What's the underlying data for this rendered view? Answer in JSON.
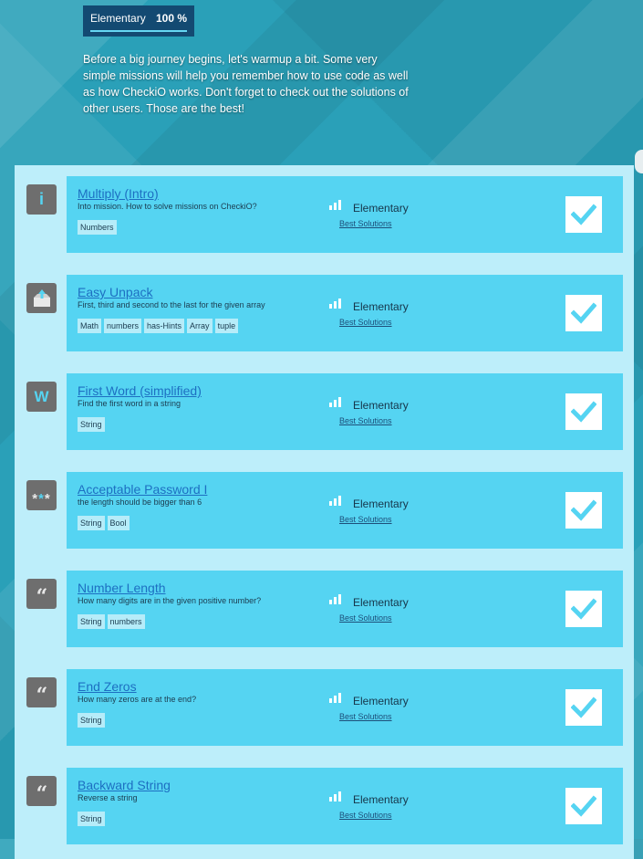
{
  "header": {
    "level_name": "Elementary",
    "progress_text": "100 %",
    "progress_fraction": 1.0,
    "intro_text": "Before a big journey begins, let's warmup a bit. Some very simple missions will help you remember how to use code as well as how CheckiO works. Don't forget to check out the solutions of other users. Those are the best!"
  },
  "missions": [
    {
      "title": "Multiply (Intro)",
      "description": "Into mission. How to solve missions on CheckiO?",
      "tags": [
        "Numbers"
      ],
      "difficulty": "Elementary",
      "best_solutions": "Best Solutions",
      "icon": "info-icon",
      "solved": true
    },
    {
      "title": "Easy Unpack",
      "description": "First, third and second to the last for the given array",
      "tags": [
        "Math",
        "numbers",
        "has-Hints",
        "Array",
        "tuple"
      ],
      "difficulty": "Elementary",
      "best_solutions": "Best Solutions",
      "icon": "unpack-box-icon",
      "solved": true
    },
    {
      "title": "First Word (simplified)",
      "description": "Find the first word in a string",
      "tags": [
        "String"
      ],
      "difficulty": "Elementary",
      "best_solutions": "Best Solutions",
      "icon": "word-w-icon",
      "solved": true
    },
    {
      "title": "Acceptable Password I",
      "description": "the length should be bigger than 6",
      "tags": [
        "String",
        "Bool"
      ],
      "difficulty": "Elementary",
      "best_solutions": "Best Solutions",
      "icon": "password-stars-icon",
      "solved": true
    },
    {
      "title": "Number Length",
      "description": "How many digits are in the given positive number?",
      "tags": [
        "String",
        "numbers"
      ],
      "difficulty": "Elementary",
      "best_solutions": "Best Solutions",
      "icon": "quote-icon",
      "solved": true
    },
    {
      "title": "End Zeros",
      "description": "How many zeros are at the end?",
      "tags": [
        "String"
      ],
      "difficulty": "Elementary",
      "best_solutions": "Best Solutions",
      "icon": "quote-icon",
      "solved": true
    },
    {
      "title": "Backward String",
      "description": "Reverse a string",
      "tags": [
        "String"
      ],
      "difficulty": "Elementary",
      "best_solutions": "Best Solutions",
      "icon": "quote-icon",
      "solved": true
    }
  ],
  "icon_glyphs": {
    "info-icon": "i",
    "word-w-icon": "W",
    "password-stars-icon": "***",
    "quote-icon": "“"
  },
  "colors": {
    "accent": "#55d4f2",
    "panel": "#bdeefa",
    "icon_bg": "#6e6e6e",
    "link": "#1d6fc2",
    "header_box": "#134a72"
  }
}
